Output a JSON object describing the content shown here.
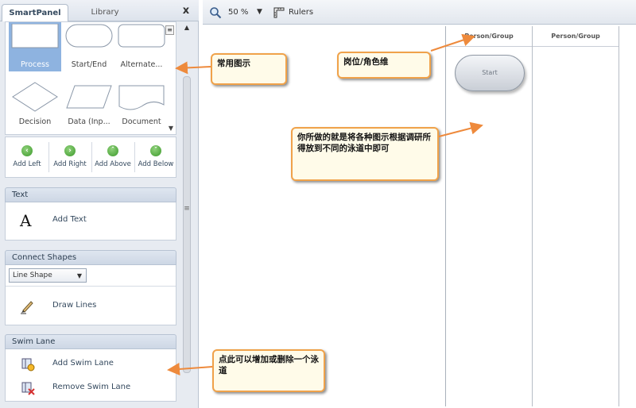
{
  "tabs": {
    "smartpanel": "SmartPanel",
    "library": "Library",
    "close": "x"
  },
  "shapes": [
    {
      "label": "Process"
    },
    {
      "label": "Start/End"
    },
    {
      "label": "Alternate..."
    },
    {
      "label": "Decision"
    },
    {
      "label": "Data (Inp..."
    },
    {
      "label": "Document"
    }
  ],
  "add_buttons": [
    {
      "label": "Add Left",
      "icon": "arrow-left-icon"
    },
    {
      "label": "Add Right",
      "icon": "arrow-right-icon"
    },
    {
      "label": "Add Above",
      "icon": "arrow-up-icon"
    },
    {
      "label": "Add Below",
      "icon": "arrow-down-icon"
    }
  ],
  "text_section": {
    "title": "Text",
    "add_text": "Add Text"
  },
  "connect_section": {
    "title": "Connect Shapes",
    "line_shape": "Line Shape",
    "draw_lines": "Draw Lines"
  },
  "swim_section": {
    "title": "Swim Lane",
    "add": "Add Swim Lane",
    "remove": "Remove Swim Lane"
  },
  "toolbar": {
    "zoom": "50 %",
    "rulers": "Rulers"
  },
  "canvas": {
    "lane_headers": [
      "Person/Group",
      "Person/Group"
    ],
    "start_label": "Start"
  },
  "callouts": {
    "common": "常用图示",
    "role": "岗位/角色维",
    "lanes": "你所做的就是将各种图示根据调研所得放到不同的泳道中即可",
    "swim": "点此可以增加或删除一个泳道"
  },
  "colors": {
    "callout_border": "#f0a24a",
    "arrow": "#ee8a3c",
    "selected_shape": "#8eb3e0",
    "add_icon": "#3d9a2c"
  }
}
